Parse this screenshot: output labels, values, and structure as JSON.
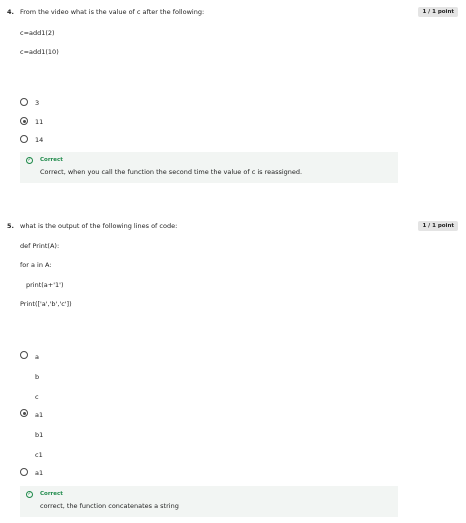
{
  "q4": {
    "number": "4.",
    "question": "From the video what is the value of c after the following:",
    "points": "1 / 1 point",
    "code": [
      "c=add1(2)",
      "c=add1(10)"
    ],
    "options": [
      "3",
      "11",
      "14"
    ],
    "selected": 1,
    "feedback_title": "Correct",
    "feedback_text": "Correct, when you call the function the second time the value of c is reassigned."
  },
  "q5": {
    "number": "5.",
    "question": "what is the output of the following lines of code:",
    "points": "1 / 1 point",
    "code": [
      "def Print(A):",
      "for a in A:",
      "print(a+'1')",
      "Print(['a','b','c'])"
    ],
    "options": [
      {
        "lines": [
          "a",
          "b",
          "c"
        ]
      },
      {
        "lines": [
          "a1",
          "b1",
          "c1"
        ]
      },
      {
        "lines": [
          "a1"
        ]
      }
    ],
    "selected": 1,
    "feedback_title": "Correct",
    "feedback_text": "correct, the function concatenates a string"
  }
}
